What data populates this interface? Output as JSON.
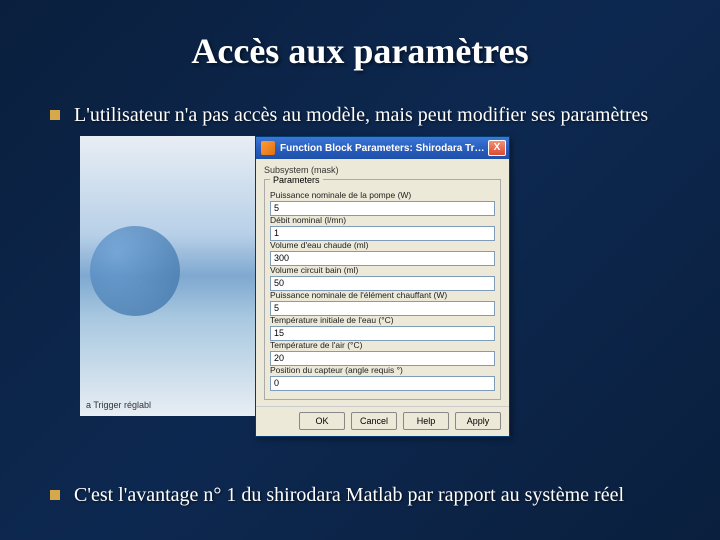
{
  "title": "Accès aux paramètres",
  "bullet1": "L'utilisateur n'a pas accès au modèle, mais peut modifier ses paramètres",
  "bullet2": "C'est l'avantage n° 1 du shirodara Matlab par rapport au système réel",
  "bg_caption": "a Trigger réglabl",
  "dialog": {
    "title": "Function Block Parameters: Shirodara Tr…",
    "close": "X",
    "section": "Subsystem (mask)",
    "group": "Parameters",
    "fields": [
      {
        "label": "Puissance nominale de la pompe (W)",
        "value": "5"
      },
      {
        "label": "Débit nominal (l/mn)",
        "value": "1"
      },
      {
        "label": "Volume d'eau chaude (ml)",
        "value": "300"
      },
      {
        "label": "Volume circuit bain (ml)",
        "value": "50"
      },
      {
        "label": "Puissance nominale de l'élément chauffant (W)",
        "value": "5"
      },
      {
        "label": "Température initiale de l'eau (°C)",
        "value": "15"
      },
      {
        "label": "Température de l'air (°C)",
        "value": "20"
      },
      {
        "label": "Position du capteur (angle requis °)",
        "value": "0"
      }
    ],
    "buttons": {
      "ok": "OK",
      "cancel": "Cancel",
      "help": "Help",
      "apply": "Apply"
    }
  }
}
